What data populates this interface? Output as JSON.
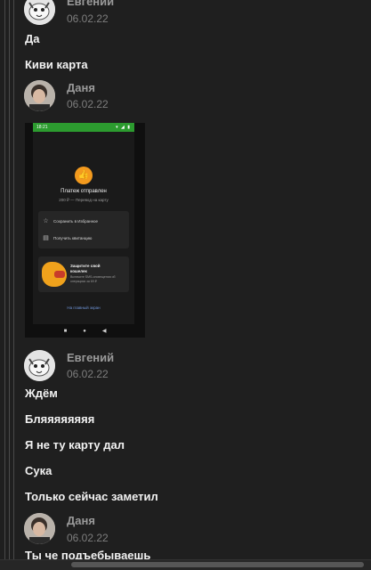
{
  "posts": [
    {
      "author": "Евгений",
      "date": "06.02.22",
      "messages": [
        "Да",
        "Киви карта"
      ]
    },
    {
      "author": "Даня",
      "date": "06.02.22",
      "screenshot": {
        "status_time": "18:21",
        "status_icons": "▾ ◢ ▮",
        "payment_icon": "👍",
        "payment_title": "Платеж отправлен",
        "payment_subtitle": "200 ₽ — Перевод на карту",
        "action_favorite": "Сохранить в Избранное",
        "action_receipt": "Получить квитанцию",
        "promo_title": "Защитите свой кошелек",
        "promo_desc": "Включите SMS-оповещения об операциях за 69 ₽",
        "home_link": "На главный экран",
        "nav_square": "■",
        "nav_circle": "●",
        "nav_back": "◀"
      }
    },
    {
      "author": "Евгений",
      "date": "06.02.22",
      "messages": [
        "Ждём",
        "Бляяяяяяяя",
        "Я не ту карту дал",
        "Сука",
        "Только сейчас заметил"
      ]
    },
    {
      "author": "Даня",
      "date": "06.02.22",
      "messages": [
        "Ты че подъебываешь"
      ]
    }
  ]
}
